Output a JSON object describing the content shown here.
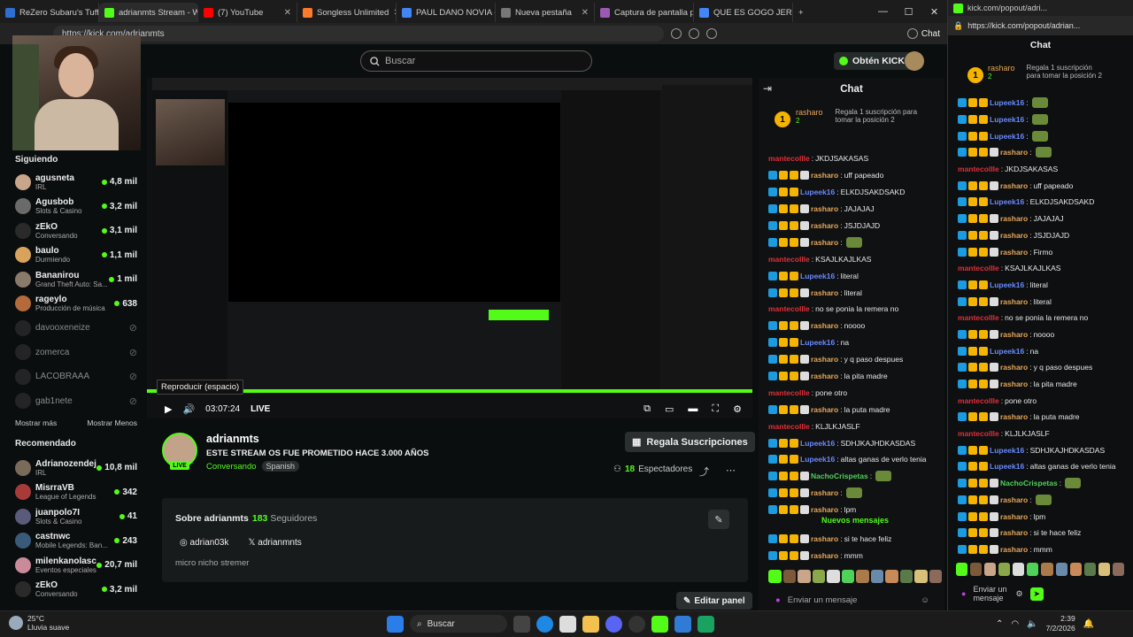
{
  "browser": {
    "tabs": [
      {
        "title": "ReZero Subaru's Tuff S",
        "color": "#2c6fd1",
        "active": false
      },
      {
        "title": "adrianmts Stream - Wa",
        "color": "#53fc18",
        "active": true
      },
      {
        "title": "(7) YouTube",
        "color": "#ff0000",
        "active": false
      },
      {
        "title": "Songless Unlimited",
        "color": "#ff7a2b",
        "active": false
      },
      {
        "title": "PAUL DANO NOVIA - B",
        "color": "#4285f4",
        "active": false
      },
      {
        "title": "Nueva pestaña",
        "color": "#777777",
        "active": false
      },
      {
        "title": "Captura de pantalla p",
        "color": "#9b59b6",
        "active": false
      },
      {
        "title": "QUE ES GOGO JERGA F",
        "color": "#4285f4",
        "active": false
      }
    ],
    "url": "https://kick.com/adrianmts",
    "chat_button": "Chat"
  },
  "header": {
    "search_placeholder": "Buscar",
    "kicks_button": "Obtén KICKs"
  },
  "sidebar": {
    "following_label": "Siguiendo",
    "following": [
      {
        "name": "agusneta",
        "cat": "IRL",
        "viewers": "4,8 mil",
        "color": "#c9a58a",
        "online": true
      },
      {
        "name": "Agusbob",
        "cat": "Slots & Casino",
        "viewers": "3,2 mil",
        "color": "#6a6a6a",
        "online": true
      },
      {
        "name": "zEkO",
        "cat": "Conversando",
        "viewers": "3,1 mil",
        "color": "#2a2a2a",
        "online": true
      },
      {
        "name": "baulo",
        "cat": "Durmiendo",
        "viewers": "1,1 mil",
        "color": "#d9a35b",
        "online": true
      },
      {
        "name": "Bananirou",
        "cat": "Grand Theft Auto: Sa...",
        "viewers": "1 mil",
        "color": "#8a7a6a",
        "online": true
      },
      {
        "name": "rageylo",
        "cat": "Producción de música",
        "viewers": "638",
        "color": "#b46a3a",
        "online": true
      },
      {
        "name": "davooxeneize",
        "cat": "",
        "viewers": "",
        "color": "#444",
        "online": false
      },
      {
        "name": "zomerca",
        "cat": "",
        "viewers": "",
        "color": "#444",
        "online": false
      },
      {
        "name": "LACOBRAAA",
        "cat": "",
        "viewers": "",
        "color": "#444",
        "online": false
      },
      {
        "name": "gab1nete",
        "cat": "",
        "viewers": "",
        "color": "#444",
        "online": false
      }
    ],
    "show_more": "Mostrar más",
    "show_less": "Mostrar Menos",
    "recommended_label": "Recomendado",
    "recommended": [
      {
        "name": "Adrianozendej...",
        "cat": "IRL",
        "viewers": "10,8 mil",
        "color": "#7a6a5a"
      },
      {
        "name": "MisrraVB",
        "cat": "League of Legends",
        "viewers": "342",
        "color": "#a83a3a"
      },
      {
        "name": "juanpolo7I",
        "cat": "Slots & Casino",
        "viewers": "41",
        "color": "#5a5a7a"
      },
      {
        "name": "castnwc",
        "cat": "Mobile Legends: Ban...",
        "viewers": "243",
        "color": "#3a5a7a"
      },
      {
        "name": "milenkanolasco",
        "cat": "Eventos especiales",
        "viewers": "20,7 mil",
        "color": "#c98a9a"
      },
      {
        "name": "zEkO",
        "cat": "Conversando",
        "viewers": "3,2 mil",
        "color": "#2a2a2a"
      }
    ]
  },
  "player": {
    "tooltip": "Reproducir (espacio)",
    "time": "03:07:24",
    "live": "LIVE"
  },
  "channel": {
    "name": "adrianmts",
    "title": "ESTE STREAM OS FUE PROMETIDO HACE 3.000 AÑOS",
    "category": "Conversando",
    "language": "Spanish",
    "live_badge": "LIVE",
    "gift_button": "Regala Suscripciones",
    "viewers": "18",
    "viewers_label": "Espectadores"
  },
  "about": {
    "title": "Sobre adrianmts",
    "followers": "183",
    "followers_label": "Seguidores",
    "instagram": "adrian03k",
    "twitter": "adrianmnts",
    "bio": "micro nicho stremer",
    "edit_panel": "Editar panel"
  },
  "chat": {
    "title": "Chat",
    "pinned_user": "rasharo",
    "pinned_count": "2",
    "pinned_text": "Regala 1 suscripción para tomar la posición 2",
    "messages": [
      {
        "user": "mantecollle",
        "text": "JKDJSAKASAS",
        "color": "#e0303a",
        "badges": 0
      },
      {
        "user": "rasharo",
        "text": "uff papeado",
        "color": "#e6a65a",
        "badges": 4
      },
      {
        "user": "Lupeek16",
        "text": "ELKDJSAKDSAKD",
        "color": "#6a8aff",
        "badges": 3
      },
      {
        "user": "rasharo",
        "text": "JAJAJAJ",
        "color": "#e6a65a",
        "badges": 4
      },
      {
        "user": "rasharo",
        "text": "JSJDJAJD",
        "color": "#e6a65a",
        "badges": 4
      },
      {
        "user": "rasharo",
        "text": "",
        "color": "#e6a65a",
        "badges": 4
      },
      {
        "user": "mantecollle",
        "text": "KSAJLKAJLKAS",
        "color": "#e0303a",
        "badges": 0
      },
      {
        "user": "Lupeek16",
        "text": "literal",
        "color": "#6a8aff",
        "badges": 3
      },
      {
        "user": "rasharo",
        "text": "literal",
        "color": "#e6a65a",
        "badges": 4
      },
      {
        "user": "mantecollle",
        "text": "no se ponia la remera no",
        "color": "#e0303a",
        "badges": 0
      },
      {
        "user": "rasharo",
        "text": "noooo",
        "color": "#e6a65a",
        "badges": 4
      },
      {
        "user": "Lupeek16",
        "text": "na",
        "color": "#6a8aff",
        "badges": 3
      },
      {
        "user": "rasharo",
        "text": "y q paso despues",
        "color": "#e6a65a",
        "badges": 4
      },
      {
        "user": "rasharo",
        "text": "la pita madre",
        "color": "#e6a65a",
        "badges": 4
      },
      {
        "user": "mantecollle",
        "text": "pone otro",
        "color": "#e0303a",
        "badges": 0
      },
      {
        "user": "rasharo",
        "text": "la puta madre",
        "color": "#e6a65a",
        "badges": 4
      },
      {
        "user": "mantecollle",
        "text": "KLJLKJASLF",
        "color": "#e0303a",
        "badges": 0
      },
      {
        "user": "Lupeek16",
        "text": "SDHJKAJHDKASDAS",
        "color": "#6a8aff",
        "badges": 3
      },
      {
        "user": "Lupeek16",
        "text": "altas ganas de verlo tenia",
        "color": "#6a8aff",
        "badges": 3
      },
      {
        "user": "NachoCrispetas",
        "text": "",
        "color": "#4fd15a",
        "badges": 4
      },
      {
        "user": "rasharo",
        "text": "",
        "color": "#e6a65a",
        "badges": 4
      },
      {
        "user": "rasharo",
        "text": "lpm",
        "color": "#e6a65a",
        "badges": 4
      }
    ],
    "new_messages": "Nuevos mensajes",
    "after_messages": [
      {
        "user": "rasharo",
        "text": "si te hace feliz",
        "color": "#e6a65a",
        "badges": 4
      },
      {
        "user": "rasharo",
        "text": "mmm",
        "color": "#e6a65a",
        "badges": 4
      }
    ],
    "input_placeholder": "Enviar un mensaje"
  },
  "popup": {
    "title_bar": "kick.com/popout/adri...",
    "url": "https://kick.com/popout/adrian...",
    "title": "Chat",
    "pinned_user": "rasharo",
    "pinned_count": "2",
    "pinned_text": "Regala 1 suscripción para tomar la posición 2",
    "messages": [
      {
        "user": "Lupeek16",
        "text": "",
        "color": "#6a8aff",
        "badges": 3
      },
      {
        "user": "Lupeek16",
        "text": "",
        "color": "#6a8aff",
        "badges": 3
      },
      {
        "user": "Lupeek16",
        "text": "",
        "color": "#6a8aff",
        "badges": 3
      },
      {
        "user": "rasharo",
        "text": "",
        "color": "#e6a65a",
        "badges": 4
      },
      {
        "user": "mantecollle",
        "text": "JKDJSAKASAS",
        "color": "#e0303a",
        "badges": 0
      },
      {
        "user": "rasharo",
        "text": "uff papeado",
        "color": "#e6a65a",
        "badges": 4
      },
      {
        "user": "Lupeek16",
        "text": "ELKDJSAKDSAKD",
        "color": "#6a8aff",
        "badges": 3
      },
      {
        "user": "rasharo",
        "text": "JAJAJAJ",
        "color": "#e6a65a",
        "badges": 4
      },
      {
        "user": "rasharo",
        "text": "JSJDJAJD",
        "color": "#e6a65a",
        "badges": 4
      },
      {
        "user": "rasharo",
        "text": "Firmo",
        "color": "#e6a65a",
        "badges": 4
      },
      {
        "user": "mantecollle",
        "text": "KSAJLKAJLKAS",
        "color": "#e0303a",
        "badges": 0
      },
      {
        "user": "Lupeek16",
        "text": "literal",
        "color": "#6a8aff",
        "badges": 3
      },
      {
        "user": "rasharo",
        "text": "literal",
        "color": "#e6a65a",
        "badges": 4
      },
      {
        "user": "mantecollle",
        "text": "no se ponia la remera no",
        "color": "#e0303a",
        "badges": 0
      },
      {
        "user": "rasharo",
        "text": "noooo",
        "color": "#e6a65a",
        "badges": 4
      },
      {
        "user": "Lupeek16",
        "text": "na",
        "color": "#6a8aff",
        "badges": 3
      },
      {
        "user": "rasharo",
        "text": "y q paso despues",
        "color": "#e6a65a",
        "badges": 4
      },
      {
        "user": "rasharo",
        "text": "la pita madre",
        "color": "#e6a65a",
        "badges": 4
      },
      {
        "user": "mantecollle",
        "text": "pone otro",
        "color": "#e0303a",
        "badges": 0
      },
      {
        "user": "rasharo",
        "text": "la puta madre",
        "color": "#e6a65a",
        "badges": 4
      },
      {
        "user": "mantecollle",
        "text": "KLJLKJASLF",
        "color": "#e0303a",
        "badges": 0
      },
      {
        "user": "Lupeek16",
        "text": "SDHJKAJHDKASDAS",
        "color": "#6a8aff",
        "badges": 3
      },
      {
        "user": "Lupeek16",
        "text": "altas ganas de verlo tenia",
        "color": "#6a8aff",
        "badges": 3
      },
      {
        "user": "NachoCrispetas",
        "text": "",
        "color": "#4fd15a",
        "badges": 4
      },
      {
        "user": "rasharo",
        "text": "",
        "color": "#e6a65a",
        "badges": 4
      },
      {
        "user": "rasharo",
        "text": "lpm",
        "color": "#e6a65a",
        "badges": 4
      },
      {
        "user": "rasharo",
        "text": "si te hace feliz",
        "color": "#e6a65a",
        "badges": 4
      },
      {
        "user": "rasharo",
        "text": "mmm",
        "color": "#e6a65a",
        "badges": 4
      }
    ],
    "input_placeholder": "Enviar un mensaje"
  },
  "taskbar": {
    "temperature": "25°C",
    "weather": "Lluvia suave",
    "search": "Buscar",
    "time": "2:39",
    "date": "7/2/2026"
  },
  "colors": {
    "accent": "#53fc18",
    "bg": "#0b0e0f"
  }
}
